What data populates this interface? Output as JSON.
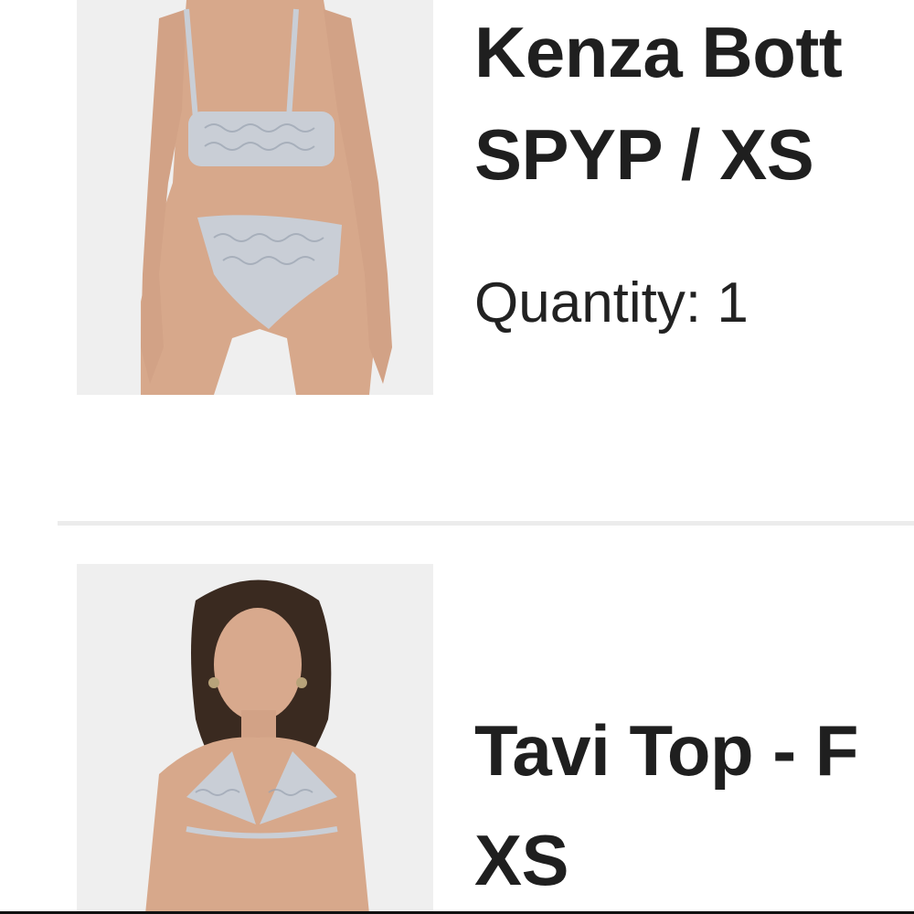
{
  "cart_items": [
    {
      "title_line1": "Kenza Bott",
      "title_line2": "SPYP / XS",
      "quantity_label": "Quantity: 1"
    },
    {
      "title_line1": "Tavi Top - F",
      "title_line2": "XS"
    }
  ],
  "colors": {
    "text": "#1f1f1f",
    "divider": "#ececec",
    "thumb_bg": "#eeeeee",
    "snake_print": "#c9ced6",
    "skin": "#d9a98c"
  }
}
